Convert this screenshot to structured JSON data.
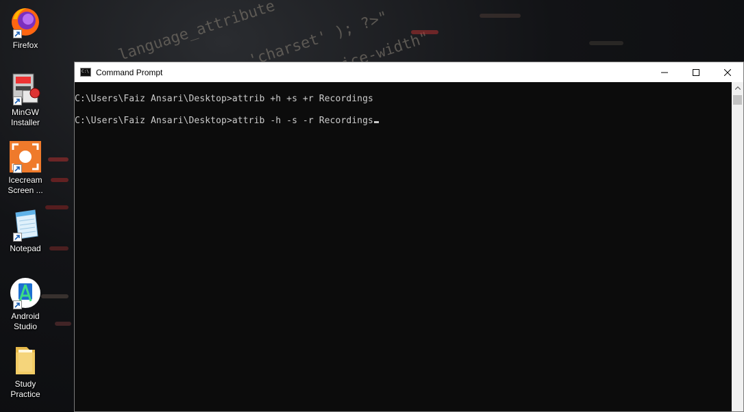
{
  "desktop": {
    "icons": [
      {
        "label": "Firefox",
        "icon": "firefox-icon"
      },
      {
        "label": "MinGW\nInstaller",
        "icon": "mingw-installer-icon"
      },
      {
        "label": "Icecream\nScreen ...",
        "icon": "icecream-screen-recorder-icon"
      },
      {
        "label": "Notepad",
        "icon": "notepad-icon"
      },
      {
        "label": "Android\nStudio",
        "icon": "android-studio-icon"
      },
      {
        "label": "Study\nPractice",
        "icon": "folder-icon"
      }
    ]
  },
  "window": {
    "title": "Command Prompt",
    "icon": "cmd-icon",
    "controls": [
      "minimize-icon",
      "maximize-icon",
      "close-icon"
    ]
  },
  "console": {
    "lines": [
      "C:\\Users\\Faiz Ansari\\Desktop>attrib +h +s +r Recordings",
      "C:\\Users\\Faiz Ansari\\Desktop>attrib -h -s -r Recordings"
    ]
  },
  "colors": {
    "console_bg": "#0c0c0c",
    "console_text": "#cccccc",
    "titlebar_bg": "#ffffff"
  }
}
